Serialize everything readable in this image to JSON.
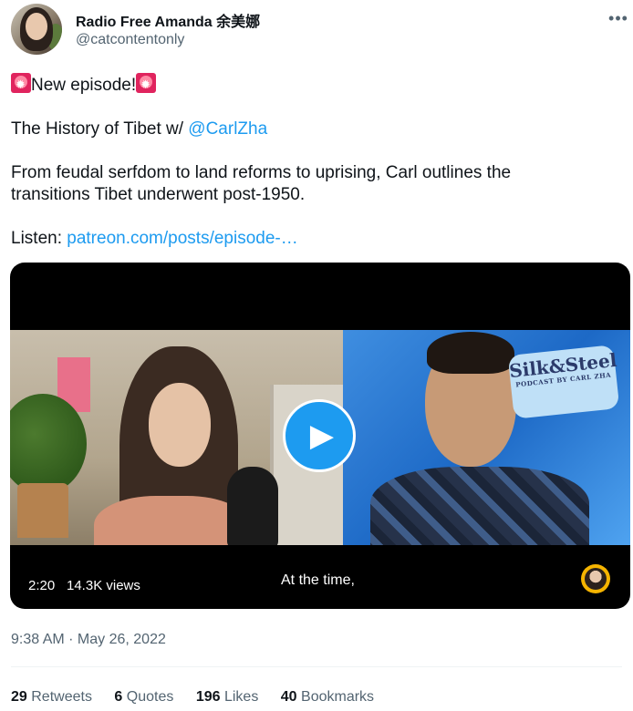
{
  "author": {
    "display_name": "Radio Free Amanda 余美娜",
    "handle": "@catcontentonly"
  },
  "icons": {
    "more": "more-horizontal-icon",
    "siren": "police-light-emoji",
    "play": "play-icon"
  },
  "tweet": {
    "headline": "New episode!",
    "title_prefix": "The History of Tibet w/ ",
    "mention": "@CarlZha",
    "body_line1": "From feudal serfdom to land reforms to uprising, Carl outlines the",
    "body_line2": "transitions Tibet underwent post-1950.",
    "listen_label": "Listen: ",
    "link_text": "patreon.com/posts/episode-…"
  },
  "video": {
    "duration": "2:20",
    "views": "14.3K views",
    "caption": "At the time,",
    "logo_line1": "Silk&Steel",
    "logo_line2": "PODCAST BY CARL ZHA"
  },
  "meta": {
    "timestamp": "9:38 AM · May 26, 2022"
  },
  "stats": {
    "retweets_count": "29",
    "retweets_label": "Retweets",
    "quotes_count": "6",
    "quotes_label": "Quotes",
    "likes_count": "196",
    "likes_label": "Likes",
    "bookmarks_count": "40",
    "bookmarks_label": "Bookmarks"
  },
  "colors": {
    "link": "#1d9bf0",
    "text": "#0f1419",
    "secondary": "#536471"
  }
}
